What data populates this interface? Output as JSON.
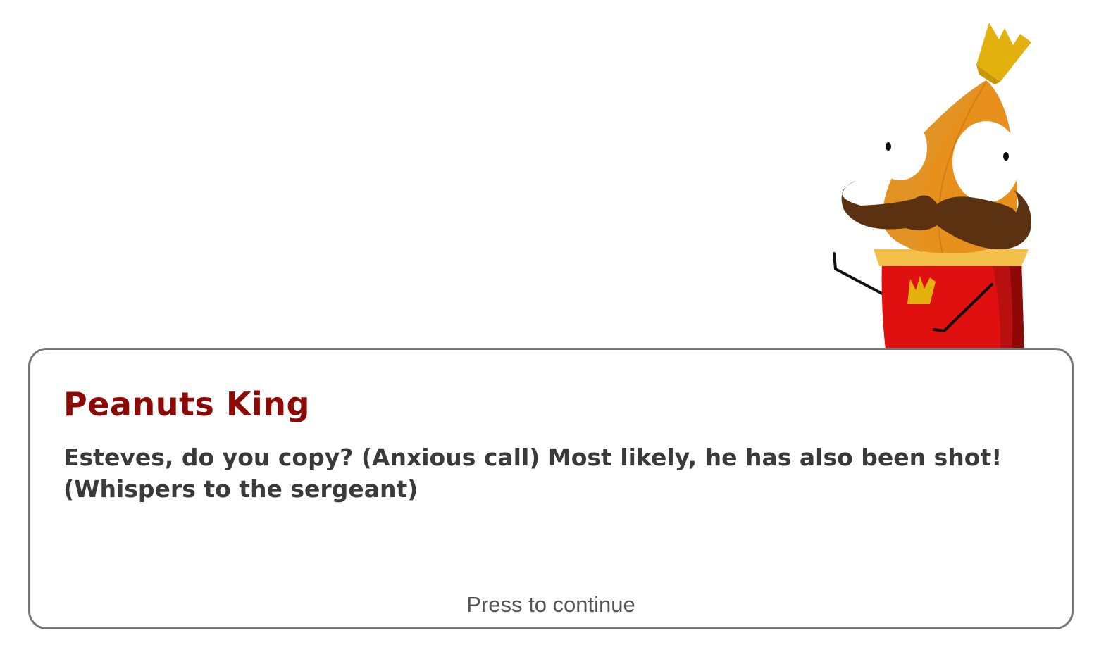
{
  "dialog": {
    "speaker": "Peanuts King",
    "text": "Esteves, do you copy? (Anxious call) Most likely, he has also been shot! (Whispers to the sergeant)",
    "continue_prompt": "Press to continue"
  },
  "character": {
    "icon": "peanut-king-character"
  },
  "colors": {
    "speaker_name": "#8b0a06",
    "dialog_text": "#3a3a3a",
    "border": "#777777",
    "peanut": "#e8901c",
    "crown": "#e3b10e",
    "robe": "#e01010",
    "mustache": "#5a3212"
  }
}
